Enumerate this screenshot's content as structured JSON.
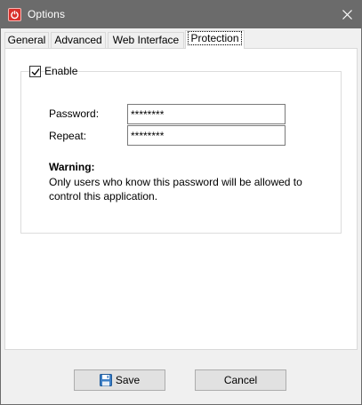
{
  "window": {
    "title": "Options",
    "app_icon": "power-icon",
    "close_icon": "close-icon"
  },
  "tabs": [
    {
      "label": "General",
      "active": false
    },
    {
      "label": "Advanced",
      "active": false
    },
    {
      "label": "Web Interface",
      "active": false
    },
    {
      "label": "Protection",
      "active": true
    }
  ],
  "protection": {
    "enable_label": "Enable",
    "enable_checked": true,
    "password_label": "Password:",
    "password_value": "********",
    "repeat_label": "Repeat:",
    "repeat_value": "********",
    "warning_title": "Warning:",
    "warning_text": "Only users who know this password will be allowed to control this application."
  },
  "buttons": {
    "save_label": "Save",
    "save_icon": "floppy-disk-icon",
    "cancel_label": "Cancel"
  }
}
